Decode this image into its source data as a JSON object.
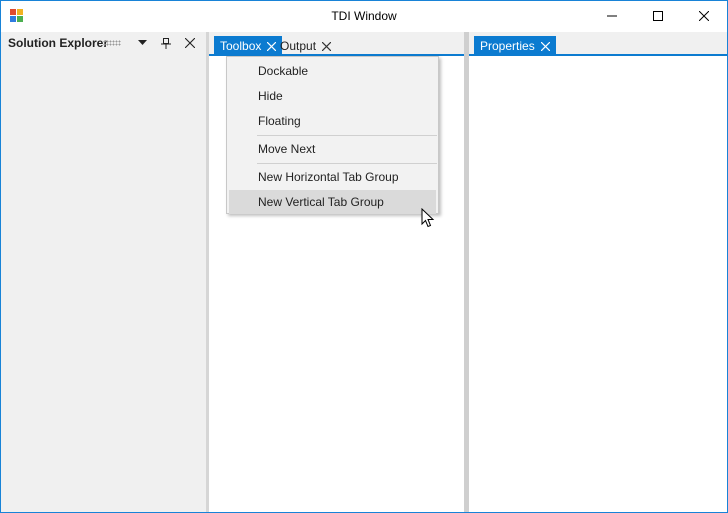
{
  "window": {
    "title": "TDI Window",
    "app_icon": "windows-app-icon",
    "controls": {
      "minimize_icon": "minimize-icon",
      "maximize_icon": "maximize-icon",
      "close_icon": "close-icon"
    },
    "accent_color": "#0c7bd0"
  },
  "left_pane": {
    "title": "Solution Explorer",
    "icons": [
      "dropdown-arrow-icon",
      "pin-icon",
      "close-icon"
    ]
  },
  "tab_group_1": {
    "tabs": [
      {
        "label": "Toolbox",
        "active": true
      },
      {
        "label": "Output",
        "active": false
      }
    ]
  },
  "tab_group_2": {
    "tabs": [
      {
        "label": "Properties",
        "active": true
      }
    ]
  },
  "context_menu": {
    "items": [
      {
        "label": "Dockable"
      },
      {
        "label": "Hide"
      },
      {
        "label": "Floating"
      },
      {
        "label": "Move Next"
      },
      {
        "label": "New Horizontal Tab Group"
      },
      {
        "label": "New Vertical Tab Group",
        "hovered": true
      }
    ]
  }
}
